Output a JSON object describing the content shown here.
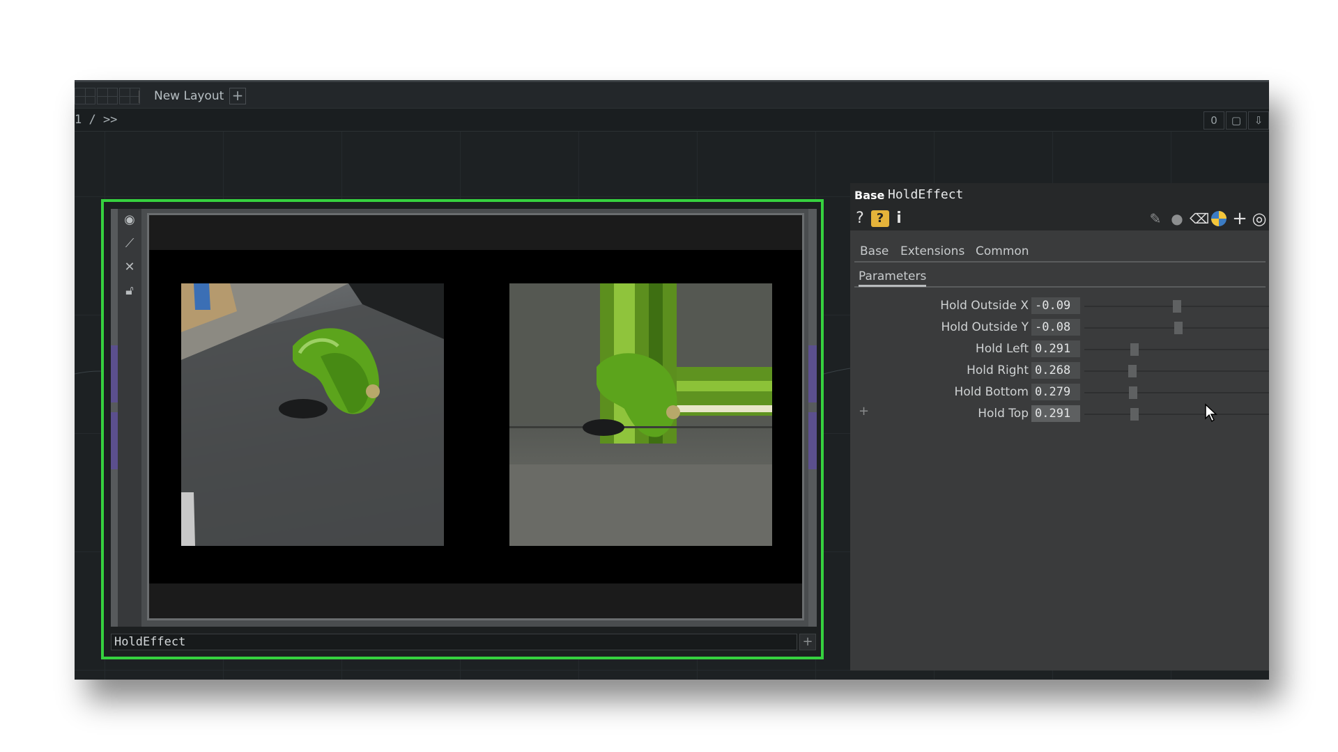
{
  "topbar": {
    "layout_label": "New Layout",
    "add_label": "+"
  },
  "pathbar": {
    "path": "1 / >>",
    "counter": "0"
  },
  "node": {
    "name": "HoldEffect",
    "add_label": "+",
    "border_color": "#36d13f"
  },
  "params": {
    "op_type": "Base",
    "op_name": "HoldEffect",
    "tabs": [
      "Base",
      "Extensions",
      "Common"
    ],
    "subtab": "Parameters",
    "add_label": "+",
    "rows": [
      {
        "label": "Hold Outside X",
        "value": "-0.09",
        "slider": 0.5
      },
      {
        "label": "Hold Outside Y",
        "value": "-0.08",
        "slider": 0.51
      },
      {
        "label": "Hold Left",
        "value": "0.291",
        "slider": 0.27
      },
      {
        "label": "Hold Right",
        "value": "0.268",
        "slider": 0.26
      },
      {
        "label": "Hold Bottom",
        "value": "0.279",
        "slider": 0.265
      },
      {
        "label": "Hold Top",
        "value": "0.291",
        "slider": 0.27
      }
    ]
  }
}
